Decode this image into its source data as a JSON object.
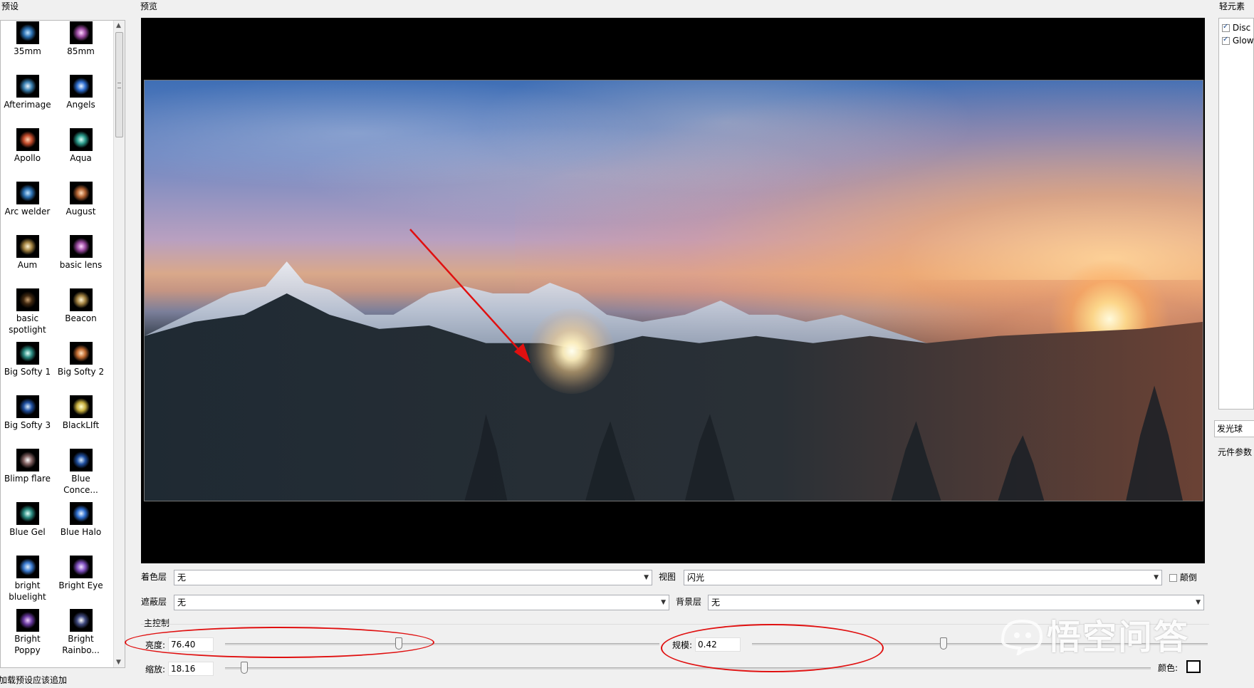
{
  "presets": {
    "title": "预设",
    "items": [
      {
        "label": "35mm",
        "thumb": "blue-flare-icon"
      },
      {
        "label": "85mm",
        "thumb": "pink-flare-icon"
      },
      {
        "label": "Afterimage",
        "thumb": "streak-flare-icon"
      },
      {
        "label": "Angels",
        "thumb": "blue-star-icon"
      },
      {
        "label": "Apollo",
        "thumb": "red-flare-icon"
      },
      {
        "label": "Aqua",
        "thumb": "teal-flare-icon"
      },
      {
        "label": "Arc welder",
        "thumb": "blue-flare-icon"
      },
      {
        "label": "August",
        "thumb": "orange-flare-icon"
      },
      {
        "label": "Aum",
        "thumb": "gold-glow-icon"
      },
      {
        "label": "basic lens",
        "thumb": "pink-flare-icon"
      },
      {
        "label": "basic spotlight",
        "thumb": "dim-glow-icon"
      },
      {
        "label": "Beacon",
        "thumb": "gold-glow-icon"
      },
      {
        "label": "Big Softy 1",
        "thumb": "teal-glow-icon"
      },
      {
        "label": "Big Softy 2",
        "thumb": "orange-glow-icon"
      },
      {
        "label": "Big Softy 3",
        "thumb": "blue-glow-icon"
      },
      {
        "label": "BlackLIft",
        "thumb": "yellow-glow-icon"
      },
      {
        "label": "Blimp flare",
        "thumb": "white-streak-icon"
      },
      {
        "label": "Blue Conce...",
        "thumb": "blue-glow-icon"
      },
      {
        "label": "Blue Gel",
        "thumb": "teal-glow-icon"
      },
      {
        "label": "Blue Halo",
        "thumb": "blue-star-icon"
      },
      {
        "label": "bright bluelight",
        "thumb": "blue-streak-icon"
      },
      {
        "label": "Bright Eye",
        "thumb": "purple-ring-icon"
      },
      {
        "label": "Bright Poppy",
        "thumb": "purple-flare-icon"
      },
      {
        "label": "Bright Rainbo...",
        "thumb": "white-star-icon"
      }
    ],
    "footer_checkbox": "加载预设应该追加"
  },
  "preview": {
    "title": "预览"
  },
  "elements_panel": {
    "title": "轻元素",
    "items": [
      {
        "label": "Disc",
        "checked": true
      },
      {
        "label": "Glow",
        "checked": true
      }
    ]
  },
  "tabs": {
    "glowball": "发光球",
    "element_params": "元件参数"
  },
  "controls": {
    "tint_layer_label": "着色层",
    "tint_layer_value": "无",
    "view_label": "视图",
    "view_value": "闪光",
    "invert_label": "颠倒",
    "mask_layer_label": "遮蔽层",
    "mask_layer_value": "无",
    "background_layer_label": "背景层",
    "background_layer_value": "无",
    "main_control_title": "主控制",
    "brightness_label": "亮度:",
    "brightness_value": "76.40",
    "brightness_level": 0.4,
    "scale_label": "规模:",
    "scale_value": "0.42",
    "scale_level": 0.42,
    "zoom_label": "缩放:",
    "zoom_value": "18.16",
    "zoom_level": 0.09,
    "color_label": "颜色:"
  },
  "watermark": "悟空问答",
  "colors": {
    "annotation": "#e01010",
    "window_bg": "#f0f0f0"
  }
}
